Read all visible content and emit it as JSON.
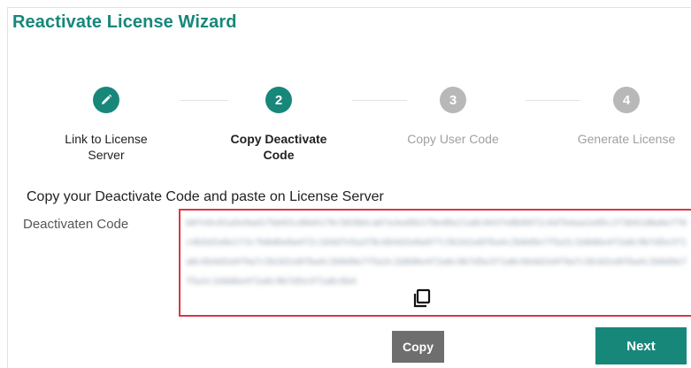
{
  "wizard": {
    "title": "Reactivate License Wizard"
  },
  "steps": [
    {
      "number": "",
      "icon": "pencil-icon",
      "label_line1": "Link to License",
      "label_line2": "Server",
      "state": "completed"
    },
    {
      "number": "2",
      "label_line1": "Copy Deactivate",
      "label_line2": "Code",
      "state": "current"
    },
    {
      "number": "3",
      "label_line1": "Copy User Code",
      "label_line2": "",
      "state": "pending"
    },
    {
      "number": "4",
      "label_line1": "Generate License",
      "label_line2": "",
      "state": "pending"
    }
  ],
  "content": {
    "instruction": "Copy your Deactivate Code and paste on License Server",
    "code_label": "Deactivaten Code",
    "code_value": "b0fe9c01a5e9ad1fbb93cd0d4170c5030dca67a3ed5b1f0ed6e21a8c0437e8b99f2c6d7b4aa1e05c2f3b91d8a6e7f0c4b5d2a9e1f3c7b8d6e0a4f2c1b9d7e5a3f8c6b4d2e0a9f7c5b3d1e8f6a4c2b0d9e7f5a3c1b8d6e4f2a0c9b7d5e3f1a8c6b4d2e0f9a7c5b3d1e8f6a4c2b0d9e7f5a3c1b8d6e4f2a0c9b7d5e3f1a8c6b4d2e0f9a7c5b3d1e8f6a4c2b0d9e7f5a3c1b8d6e4f2a0c9b7d5e3f1a8c6b4",
    "copy_icon": "copy-icon"
  },
  "buttons": {
    "copy_label": "Copy",
    "next_label": "Next"
  },
  "colors": {
    "accent": "#17877a",
    "inactive": "#b8b8b8",
    "highlight_border": "#dc3545",
    "copy_button": "#6e6e6e"
  }
}
